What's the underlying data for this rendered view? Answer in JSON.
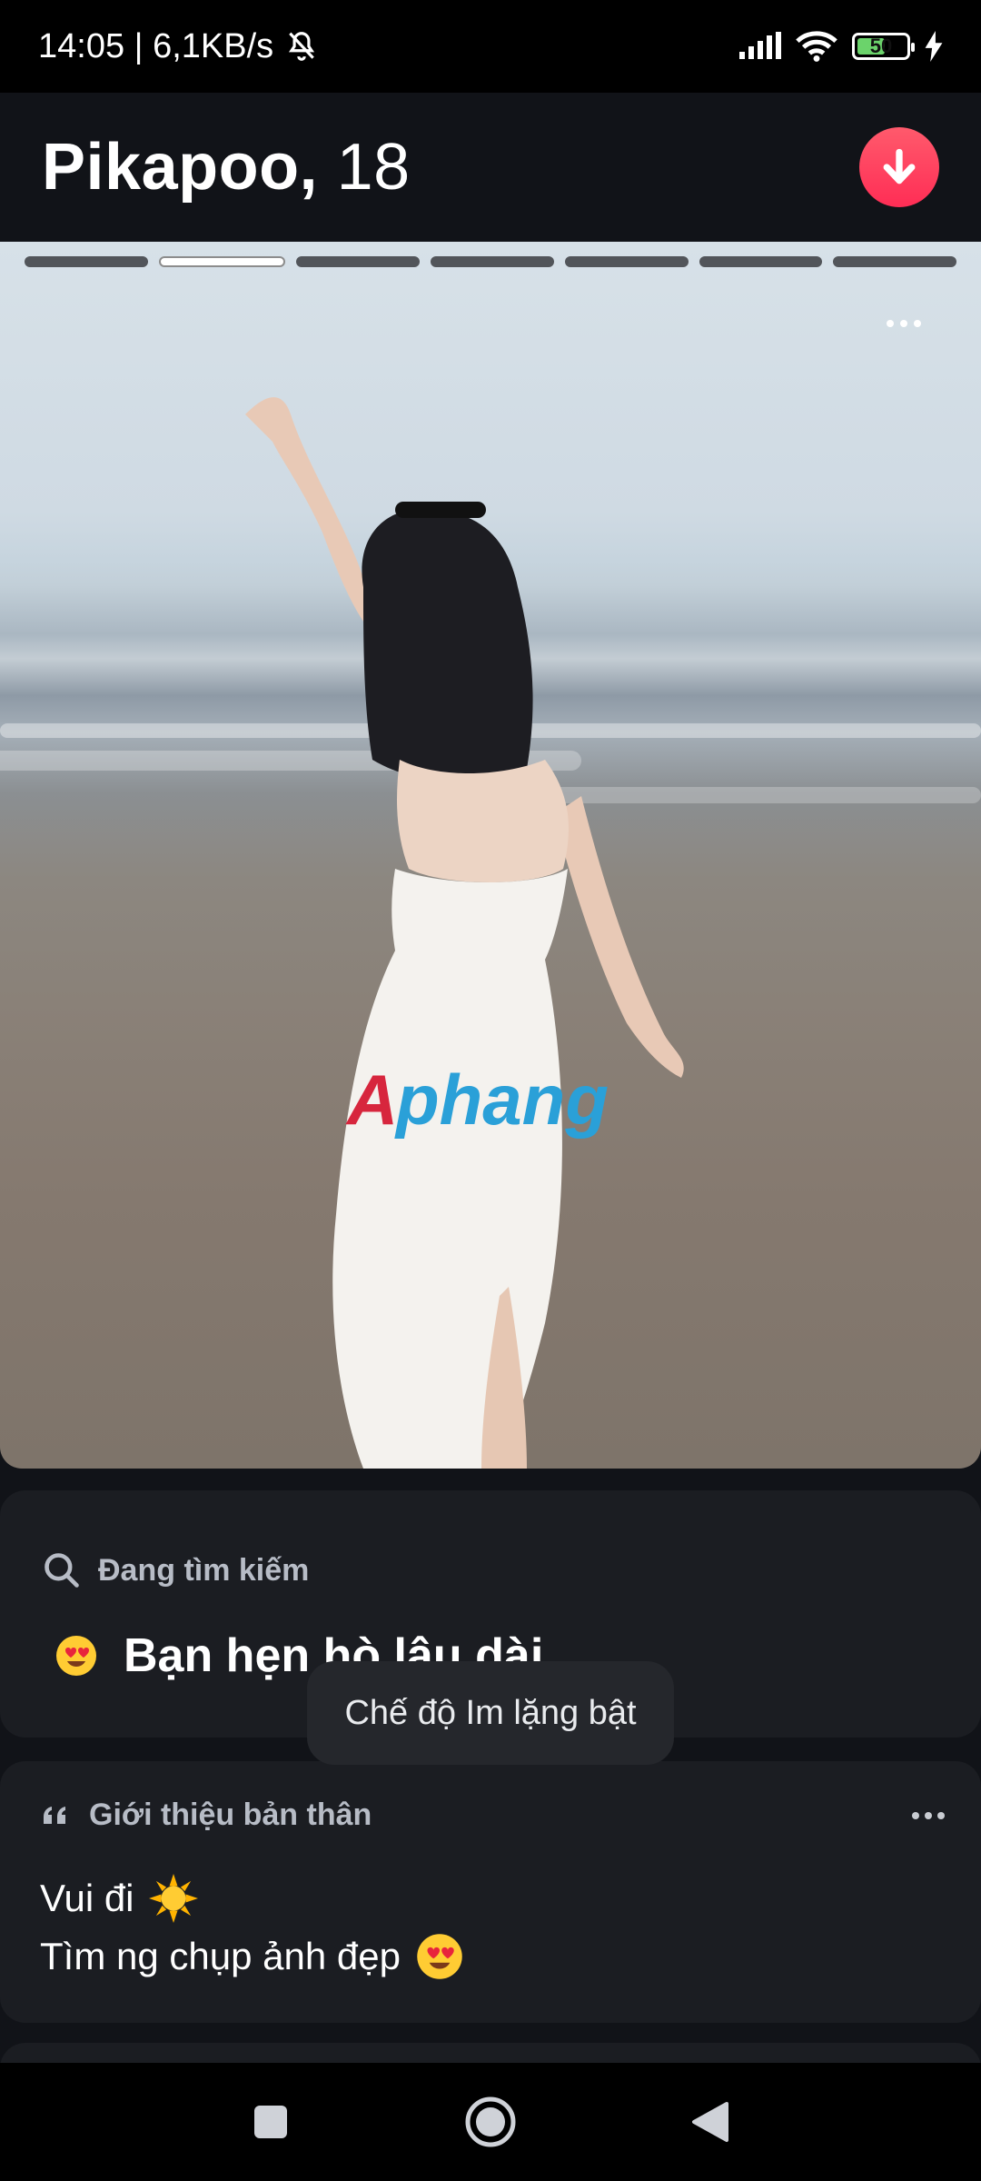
{
  "status_bar": {
    "time_speed": "14:05 | 6,1KB/s",
    "battery": "50"
  },
  "profile": {
    "name": "Pikapoo,",
    "age": "18"
  },
  "photo": {
    "total_photos": 7,
    "active_photo_index": 1,
    "watermark": "Aphang"
  },
  "looking_for": {
    "label": "Đang tìm kiếm",
    "value": "Bạn hẹn hò lâu dài"
  },
  "about": {
    "label": "Giới thiệu bản thân",
    "lines": [
      "Vui đi",
      "Tìm ng chụp ảnh đẹp"
    ]
  },
  "toast": {
    "text": "Chế độ Im lặng bật"
  },
  "colors": {
    "accent": "#ff2d55",
    "background": "#111318",
    "card": "#1b1d22"
  }
}
